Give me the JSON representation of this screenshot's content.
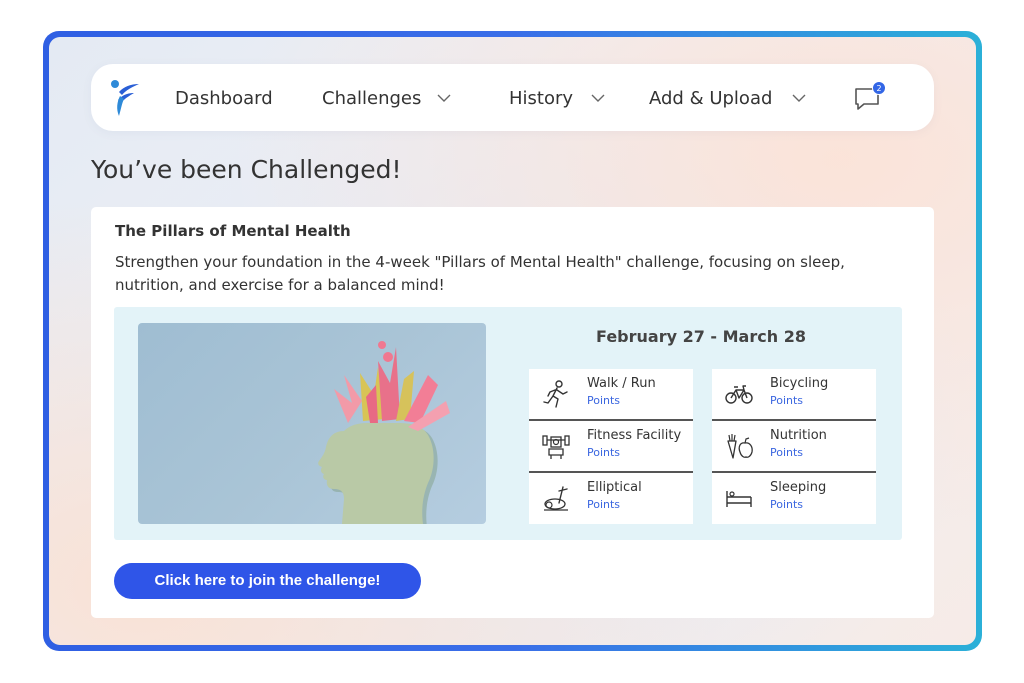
{
  "nav": {
    "items": [
      {
        "label": "Dashboard"
      },
      {
        "label": "Challenges"
      },
      {
        "label": "History"
      },
      {
        "label": "Add & Upload"
      }
    ],
    "messages_badge": "2"
  },
  "page_title": "You’ve been Challenged!",
  "challenge": {
    "title": "The Pillars of Mental Health",
    "description": "Strengthen your foundation in the 4-week \"Pillars of Mental Health\" challenge, focusing on sleep, nutrition, and exercise for a balanced mind!",
    "dates": "February 27 - March 28",
    "activities": [
      {
        "label": "Walk / Run",
        "points": "Points",
        "icon": "walk-run-icon"
      },
      {
        "label": "Bicycling",
        "points": "Points",
        "icon": "bicycle-icon"
      },
      {
        "label": "Fitness Facility",
        "points": "Points",
        "icon": "fitness-facility-icon"
      },
      {
        "label": "Nutrition",
        "points": "Points",
        "icon": "nutrition-icon"
      },
      {
        "label": "Elliptical",
        "points": "Points",
        "icon": "elliptical-icon"
      },
      {
        "label": "Sleeping",
        "points": "Points",
        "icon": "bed-icon"
      }
    ],
    "join_label": "Click here to join the challenge!"
  },
  "colors": {
    "accent": "#2f55e8",
    "points": "#3a66e0",
    "panel_bg": "#e3f3f8",
    "frame_gradient": [
      "#2f5fe3",
      "#2bb0d8"
    ]
  }
}
